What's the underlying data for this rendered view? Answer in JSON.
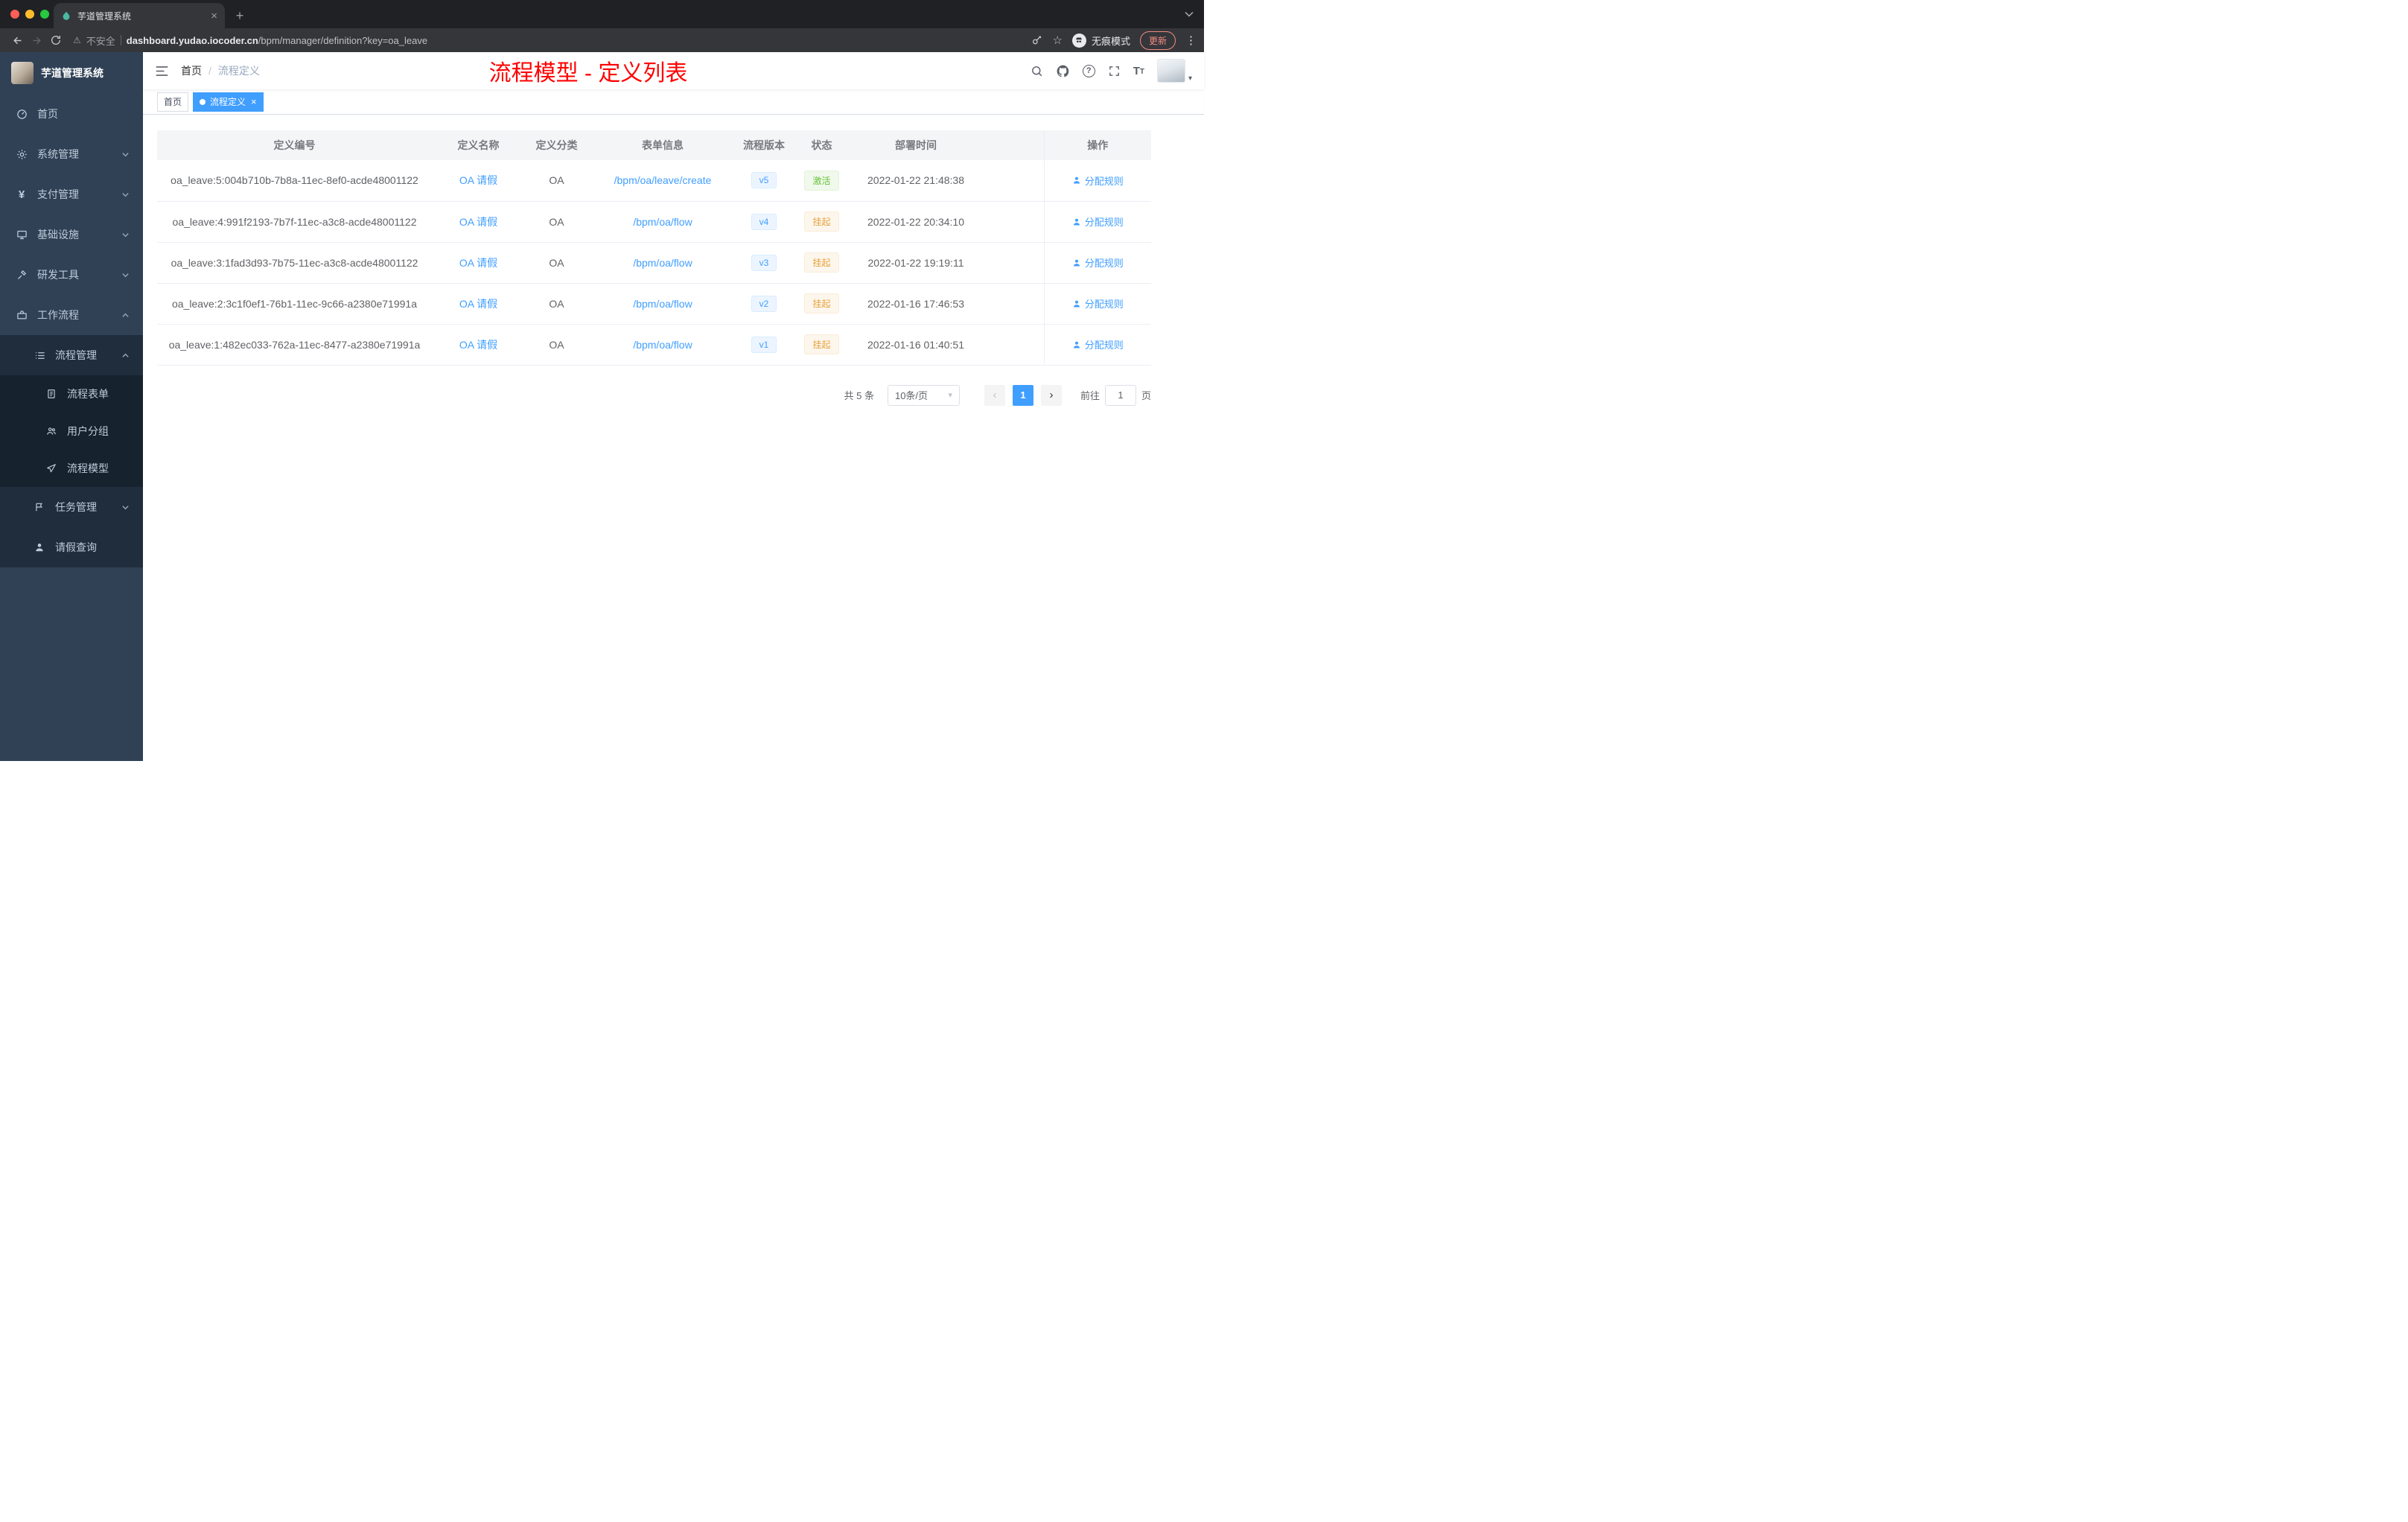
{
  "glyphs": {
    "close": "×",
    "plus": "+",
    "warning": "⚠",
    "star": "☆",
    "dots": "⋮",
    "help": "?",
    "caret": "▾",
    "yen": "¥",
    "prev": "‹",
    "next": "›",
    "slash": "/",
    "t_large": "T",
    "t_small": "T",
    "dot_sep": "|"
  },
  "browser": {
    "tab_title": "芋道管理系统",
    "security_label": "不安全",
    "url_host": "dashboard.yudao.iocoder.cn",
    "url_path": "/bpm/manager/definition?key=oa_leave",
    "incognito_label": "无痕模式",
    "update_label": "更新"
  },
  "sidebar": {
    "logo_title": "芋道管理系统",
    "items": [
      {
        "label": "首页"
      },
      {
        "label": "系统管理"
      },
      {
        "label": "支付管理"
      },
      {
        "label": "基础设施"
      },
      {
        "label": "研发工具"
      },
      {
        "label": "工作流程"
      },
      {
        "label": "流程管理"
      },
      {
        "label": "流程表单"
      },
      {
        "label": "用户分组"
      },
      {
        "label": "流程模型"
      },
      {
        "label": "任务管理"
      },
      {
        "label": "请假查询"
      }
    ]
  },
  "navbar": {
    "breadcrumb_home": "首页",
    "breadcrumb_current": "流程定义",
    "annotation": "流程模型 - 定义列表"
  },
  "tags": {
    "home": "首页",
    "active": "流程定义"
  },
  "table": {
    "columns": [
      "定义编号",
      "定义名称",
      "定义分类",
      "表单信息",
      "流程版本",
      "状态",
      "部署时间",
      "操作"
    ],
    "rows": [
      {
        "id": "oa_leave:5:004b710b-7b8a-11ec-8ef0-acde48001122",
        "name": "OA 请假",
        "category": "OA",
        "form": "/bpm/oa/leave/create",
        "version": "v5",
        "status": "激活",
        "status_type": "success",
        "time": "2022-01-22 21:48:38",
        "action": "分配规则"
      },
      {
        "id": "oa_leave:4:991f2193-7b7f-11ec-a3c8-acde48001122",
        "name": "OA 请假",
        "category": "OA",
        "form": "/bpm/oa/flow",
        "version": "v4",
        "status": "挂起",
        "status_type": "warning",
        "time": "2022-01-22 20:34:10",
        "action": "分配规则"
      },
      {
        "id": "oa_leave:3:1fad3d93-7b75-11ec-a3c8-acde48001122",
        "name": "OA 请假",
        "category": "OA",
        "form": "/bpm/oa/flow",
        "version": "v3",
        "status": "挂起",
        "status_type": "warning",
        "time": "2022-01-22 19:19:11",
        "action": "分配规则"
      },
      {
        "id": "oa_leave:2:3c1f0ef1-76b1-11ec-9c66-a2380e71991a",
        "name": "OA 请假",
        "category": "OA",
        "form": "/bpm/oa/flow",
        "version": "v2",
        "status": "挂起",
        "status_type": "warning",
        "time": "2022-01-16 17:46:53",
        "action": "分配规则"
      },
      {
        "id": "oa_leave:1:482ec033-762a-11ec-8477-a2380e71991a",
        "name": "OA 请假",
        "category": "OA",
        "form": "/bpm/oa/flow",
        "version": "v1",
        "status": "挂起",
        "status_type": "warning",
        "time": "2022-01-16 01:40:51",
        "action": "分配规则"
      }
    ]
  },
  "pagination": {
    "total": "共 5 条",
    "page_size": "10条/页",
    "current_page": "1",
    "goto_label": "前往",
    "goto_value": "1",
    "goto_unit": "页"
  }
}
